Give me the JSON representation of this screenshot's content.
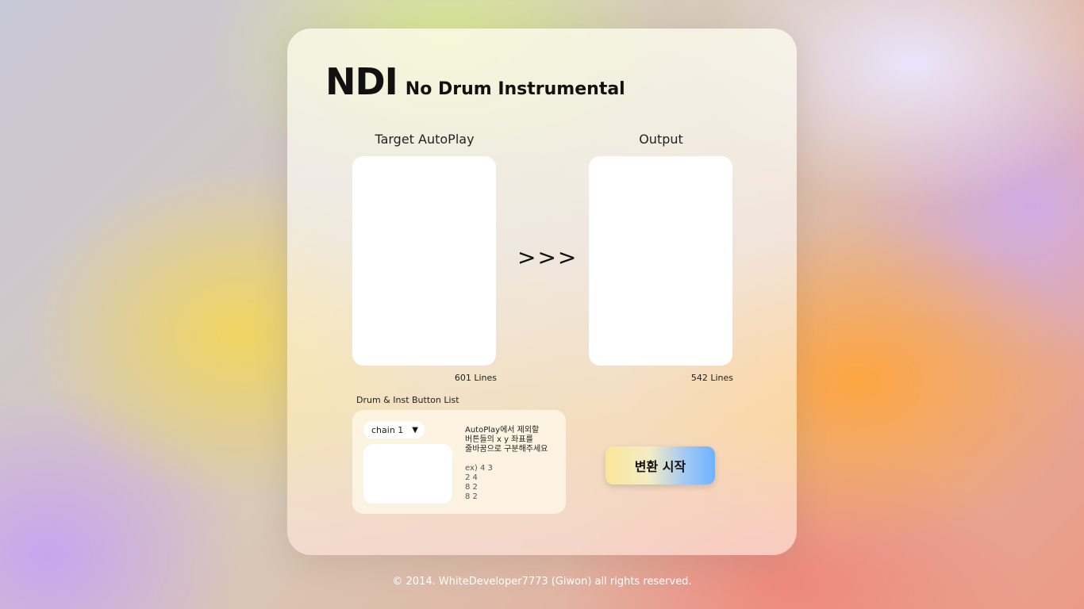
{
  "brand": {
    "main": "NDI",
    "sub": "No Drum Instrumental"
  },
  "target_panel": {
    "label": "Target AutoPlay",
    "value": "",
    "line_count": "601 Lines"
  },
  "arrow": ">>>",
  "output_panel": {
    "label": "Output",
    "value": "",
    "line_count": "542 Lines"
  },
  "button_list": {
    "label": "Drum & Inst Button List",
    "chain_selected": "chain 1",
    "input_value": "",
    "hint_lines": [
      "AutoPlay에서 제외할",
      "버튼들의 x y 좌표를",
      "줄바꿈으로 구분해주세요"
    ],
    "example_lines": [
      "ex) 4 3",
      "2 4",
      "8 2",
      "8 2"
    ]
  },
  "convert_button": {
    "label": "변환 시작"
  },
  "footer": {
    "text": "© 2014. WhiteDeveloper7773 (Giwon) all rights reserved."
  },
  "colors": {
    "button_gradient_start": "#fbe59a",
    "button_gradient_end": "#6fb3ff",
    "text": "#111111"
  }
}
